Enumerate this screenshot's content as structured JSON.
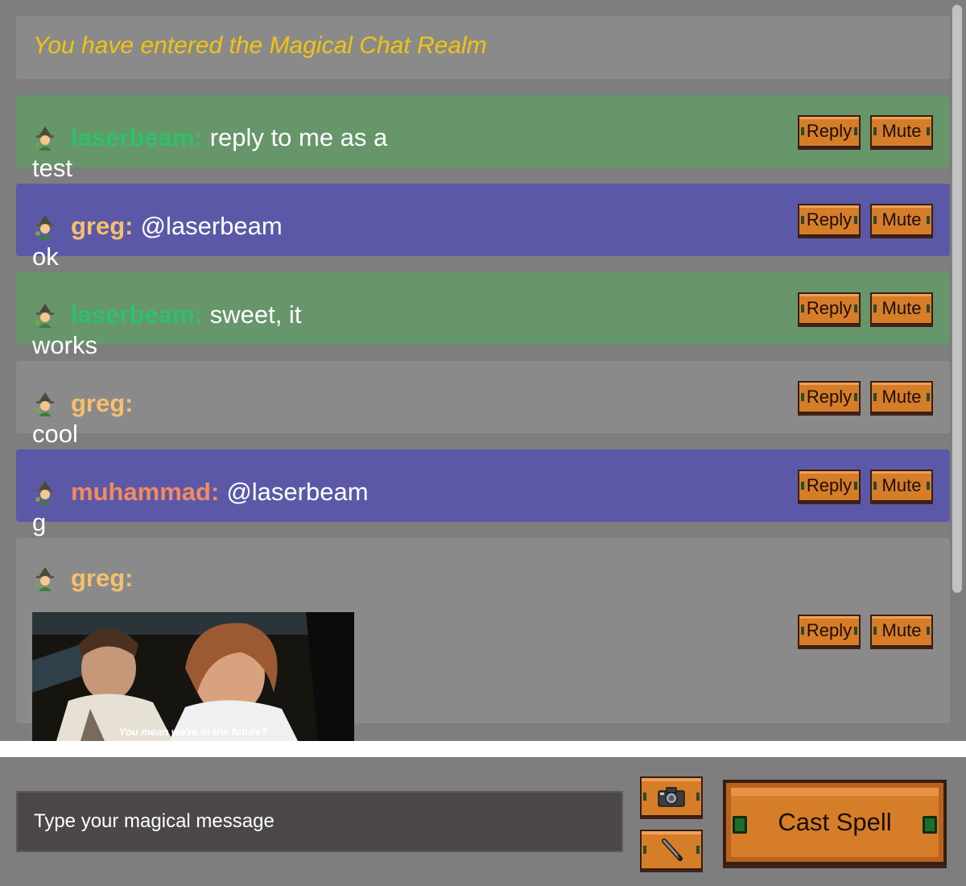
{
  "banner": {
    "text": "You have entered the Magical Chat Realm"
  },
  "messages": [
    {
      "user": "laserbeam:",
      "text": "reply to me as a",
      "overflow": "test",
      "color_scheme": "green",
      "user_color": "#2fc06b"
    },
    {
      "user": "greg:",
      "text": "@laserbeam",
      "overflow": "ok",
      "color_scheme": "purple",
      "user_color": "#f6c06a"
    },
    {
      "user": "laserbeam:",
      "text": "sweet, it",
      "overflow": "works",
      "color_scheme": "green",
      "user_color": "#2fc06b"
    },
    {
      "user": "greg:",
      "text": "",
      "overflow": "cool",
      "color_scheme": "gray",
      "user_color": "#f6c06a"
    },
    {
      "user": "muhammad:",
      "text": "@laserbeam",
      "overflow": "g",
      "color_scheme": "purple",
      "user_color": "#f38a5f"
    },
    {
      "user": "greg:",
      "text": "",
      "gif_caption": "You mean we're in the future?",
      "color_scheme": "gray",
      "user_color": "#f6c06a"
    }
  ],
  "actions": {
    "reply_label": "Reply",
    "mute_label": "Mute"
  },
  "composer": {
    "placeholder": "Type your magical message",
    "camera_icon": "camera-icon",
    "pen_icon": "pen-icon",
    "cast_label": "Cast Spell"
  },
  "colors": {
    "background": "#7e7e7e",
    "banner_text": "#f2c40f",
    "green_message": "#66966a",
    "purple_message": "#5b59a7",
    "gray_message": "#8a8a8a",
    "button_orange": "#d67d29"
  }
}
